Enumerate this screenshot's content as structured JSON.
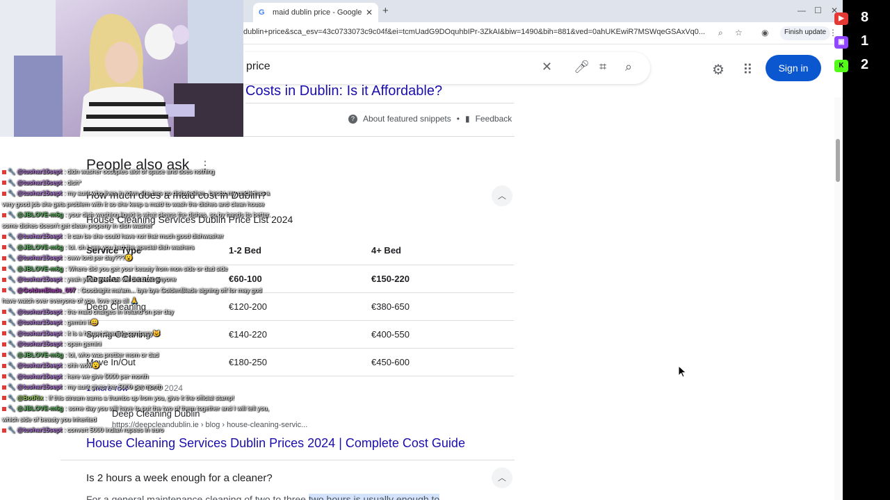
{
  "browser": {
    "tab_title": "maid dublin price - Google",
    "tab_icon": "G",
    "tab_close": "✕",
    "new_tab": "+",
    "url": "dublin+price&sca_esv=43c0733073c9c04f&ei=tcmUadG9DOquhbIPr-3ZkAI&biw=1490&bih=881&ved=0ahUKEwiR7MSWqeGSAxVq0...",
    "finish_update": "Finish update"
  },
  "search": {
    "query": "price",
    "sign_in": "Sign in"
  },
  "featured": {
    "partial_title": "Costs in Dublin: Is it Affordable?",
    "about": "About featured snippets",
    "separator": "•",
    "feedback": "Feedback"
  },
  "paa": {
    "title": "People also ask",
    "question1": "How much does a maid cost in Dublin?",
    "question2": "Is 2 hours a week enough for a cleaner?"
  },
  "table": {
    "title": "House Cleaning Services Dublin Price List 2024",
    "headers": [
      "Service Type",
      "1-2 Bed",
      "4+ Bed"
    ],
    "rows": [
      [
        "Regular Cleaning",
        "€60-100",
        "€150-220"
      ],
      [
        "Deep Cleaning",
        "€120-200",
        "€380-650"
      ],
      [
        "Spring Cleaning",
        "€140-220",
        "€400-550"
      ],
      [
        "Move In/Out",
        "€180-250",
        "€450-600"
      ]
    ],
    "more_rows": "1 more row",
    "date": "20 Dec 2024"
  },
  "result": {
    "site_name": "Deep Cleaning Dublin",
    "site_url": "https://deepcleandublin.ie › blog › house-cleaning-servic...",
    "title": "House Cleaning Services Dublin Prices 2024 | Complete Cost Guide"
  },
  "snippet": {
    "text": "For a general maintenance cleaning of two to three",
    "highlight": "two hours is usually enough to"
  },
  "stats": {
    "youtube": "8",
    "twitch": "1",
    "kick": "2"
  },
  "chat": [
    {
      "user": "@tushar15sept",
      "color": "#b57edc",
      "text": "didn washer occupies alot of space and does nothing"
    },
    {
      "user": "@tushar15sept",
      "color": "#b57edc",
      "text": "dish*"
    },
    {
      "user": "@tushar15sept",
      "color": "#b57edc",
      "text": "my aunt who lives in town she has no dishwasher.. becoz my uncle has a very good job she gets problem with it so she keep a maid to wash the dishes and clean house"
    },
    {
      "user": "@JBLOVE-m6g",
      "color": "#66bb6a",
      "text": "your dish washing liquid is what cleans the dishes, so by hands its better. some dishes doesn't get clean properly in dish washer"
    },
    {
      "user": "@tushar15sept",
      "color": "#b57edc",
      "text": "it can be she could have not that much good dishwasher"
    },
    {
      "user": "@JBLOVE-m6g",
      "color": "#66bb6a",
      "text": "lol. oh I see you had the special dish washers"
    },
    {
      "user": "@tushar15sept",
      "color": "#b57edc",
      "text": "oww lord per day???😮"
    },
    {
      "user": "@JBLOVE-m6g",
      "color": "#66bb6a",
      "text": "Where did you get your beauty from mon side or dad side"
    },
    {
      "user": "@tushar15sept",
      "color": "#b57edc",
      "text": "yeah yeah even us we dnt trust anyone"
    },
    {
      "user": "@GoldenBlade_007",
      "color": "#ab47bc",
      "text": "Goodnight ma'am... bye bye GoldenBlade signing off for may god have watch over everyone of you. love you all 🙏"
    },
    {
      "user": "@tushar15sept",
      "color": "#b57edc",
      "text": "the maid charges in ireland on per day"
    },
    {
      "user": "@tushar15sept",
      "color": "#b57edc",
      "text": "gemini it😄"
    },
    {
      "user": "@tushar15sept",
      "color": "#b57edc",
      "text": "it is a house cleaning company😺"
    },
    {
      "user": "@tushar15sept",
      "color": "#b57edc",
      "text": "open gemini"
    },
    {
      "user": "@JBLOVE-m6g",
      "color": "#66bb6a",
      "text": "lol, who was prettier mom or dad"
    },
    {
      "user": "@tushar15sept",
      "color": "#b57edc",
      "text": "ohh wow😮"
    },
    {
      "user": "@tushar15sept",
      "color": "#b57edc",
      "text": "here we give 5000 per month"
    },
    {
      "user": "@tushar15sept",
      "color": "#b57edc",
      "text": "my aunt gives her 5000 per month"
    },
    {
      "user": "@BotRix",
      "color": "#9ccc65",
      "text": "If this stream earns a thumbs up from you, give it the official stamp!"
    },
    {
      "user": "@JBLOVE-m6g",
      "color": "#66bb6a",
      "text": "some day you will have to put the two of them together and I will tell you, which side of beauty you inherited"
    },
    {
      "user": "@tushar15sept",
      "color": "#b57edc",
      "text": "convert 5000 indian rupees in euro"
    }
  ]
}
